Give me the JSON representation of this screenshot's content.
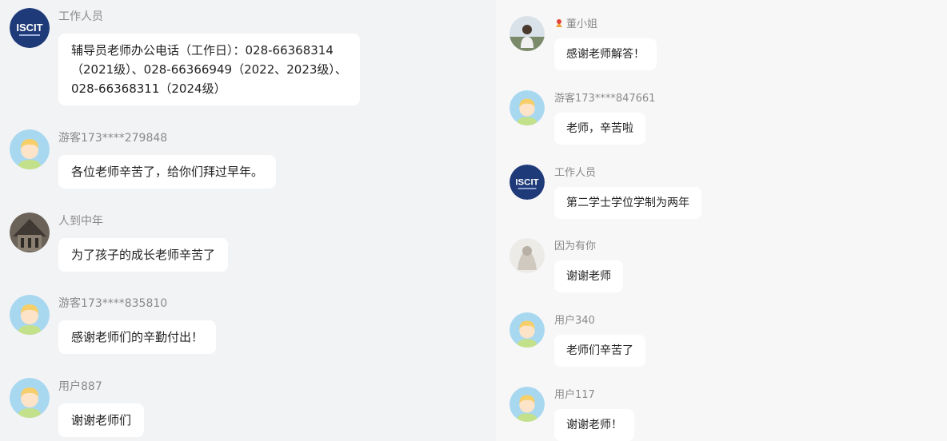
{
  "left": {
    "messages": [
      {
        "user": "工作人员",
        "avatar": "iscit-logo",
        "lines": [
          "辅导员老师办公电话（工作日）：028-66368314",
          "（2021级）、028-66366949（2022、2023级）、",
          "028-66368311（2024级）"
        ]
      },
      {
        "user": "游客173****279848",
        "avatar": "default-child-avatar",
        "lines": [
          "各位老师辛苦了，给你们拜过早年。"
        ]
      },
      {
        "user": "人到中年",
        "avatar": "photo-avatar",
        "lines": [
          "为了孩子的成长老师辛苦了"
        ]
      },
      {
        "user": "游客173****835810",
        "avatar": "default-child-avatar",
        "lines": [
          "感谢老师们的辛勤付出！"
        ]
      },
      {
        "user": "用户887",
        "avatar": "default-child-avatar",
        "lines": [
          "谢谢老师们"
        ]
      }
    ]
  },
  "right": {
    "messages": [
      {
        "user": "董小姐",
        "avatar": "photo-avatar",
        "badge": "flower-badge-icon",
        "lines": [
          "感谢老师解答！"
        ]
      },
      {
        "user": "游客173****847661",
        "avatar": "default-child-avatar",
        "lines": [
          "老师，辛苦啦"
        ]
      },
      {
        "user": "工作人员",
        "avatar": "iscit-logo",
        "lines": [
          "第二学士学位学制为两年"
        ]
      },
      {
        "user": "因为有你",
        "avatar": "photo-avatar",
        "lines": [
          "谢谢老师"
        ]
      },
      {
        "user": "用户340",
        "avatar": "default-child-avatar",
        "lines": [
          "老师们辛苦了"
        ]
      },
      {
        "user": "用户117",
        "avatar": "default-child-avatar",
        "lines": [
          "谢谢老师！"
        ]
      }
    ]
  },
  "logo_text": "ISCIT",
  "colors": {
    "logo_bg": "#1f3a78",
    "avatar_bg": "#a8d8f0",
    "bubble_bg": "#ffffff",
    "username": "#8a8a8a"
  }
}
